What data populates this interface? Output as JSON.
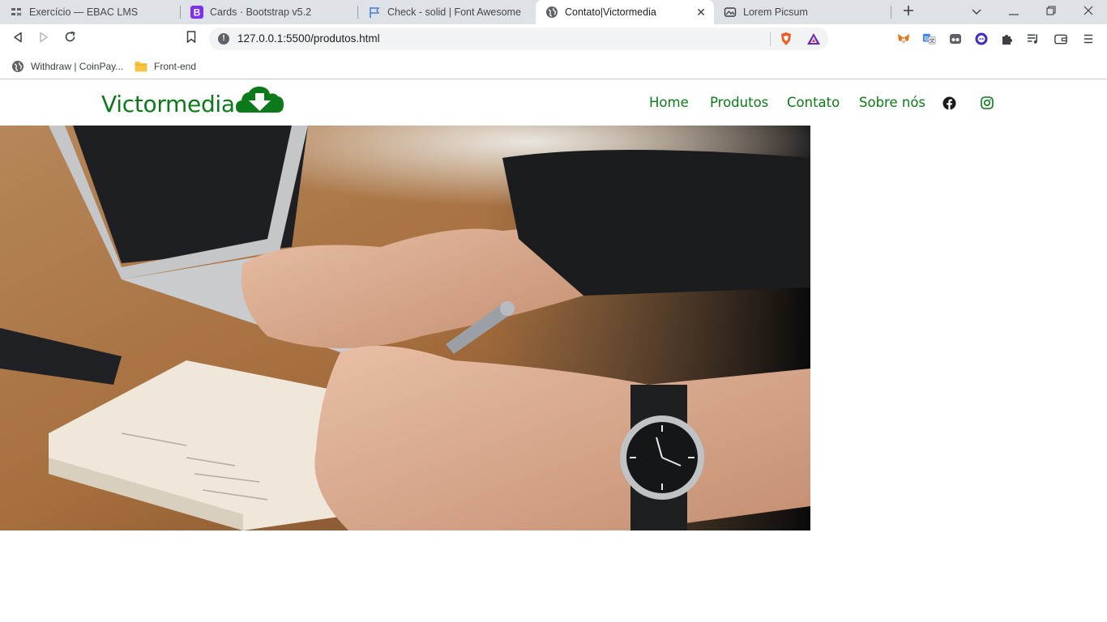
{
  "browser": {
    "tabs": [
      {
        "title": "Exercício — EBAC LMS",
        "icon": "ebac-icon",
        "active": false
      },
      {
        "title": "Cards · Bootstrap v5.2",
        "icon": "bootstrap-icon",
        "active": false
      },
      {
        "title": "Check - solid | Font Awesome",
        "icon": "flag-icon",
        "active": false
      },
      {
        "title": "Contato|Victormedia",
        "icon": "globe-icon",
        "active": true
      },
      {
        "title": "Lorem Picsum",
        "icon": "picsum-icon",
        "active": false
      }
    ],
    "new_tab_icon": "plus-icon",
    "address": {
      "url": "127.0.0.1:5500/produtos.html",
      "security_icon": "info-icon"
    },
    "extensions": [
      "metamask-icon",
      "translate-icon",
      "reader-icon",
      "chat-icon",
      "puzzle-icon",
      "playlist-icon",
      "wallet-icon",
      "menu-icon"
    ],
    "bookmarks": [
      {
        "label": "Withdraw | CoinPay...",
        "icon": "globe-icon"
      },
      {
        "label": "Front-end",
        "icon": "folder-icon"
      }
    ]
  },
  "site": {
    "logo": {
      "text": "Victormedia",
      "icon": "cloud-download-icon"
    },
    "nav": [
      {
        "label": "Home"
      },
      {
        "label": "Produtos"
      },
      {
        "label": "Contato"
      },
      {
        "label": "Sobre nós"
      }
    ],
    "social": [
      "facebook-icon",
      "instagram-icon"
    ],
    "hero": {
      "description": "photo"
    },
    "colors": {
      "brand": "#0c7a1a",
      "tabstrip": "#dee1e6",
      "omnibox": "#f1f3f4"
    }
  }
}
